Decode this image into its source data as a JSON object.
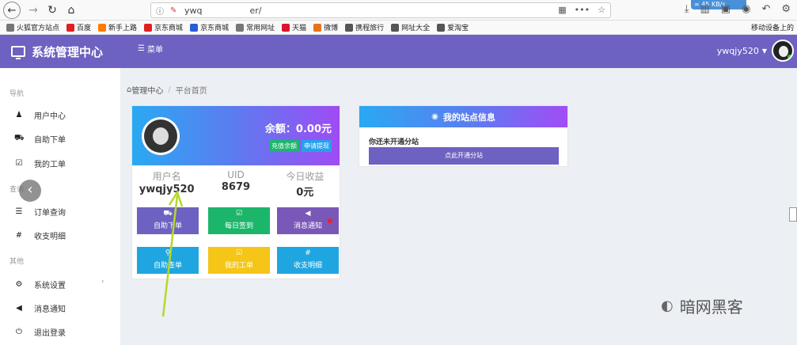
{
  "browser": {
    "url_prefix": "ywq",
    "url_suffix": "er/",
    "speed": "45 KB/s",
    "bookmarks": [
      {
        "label": "火狐官方站点",
        "color": "#777"
      },
      {
        "label": "百度",
        "color": "#e02020"
      },
      {
        "label": "新手上路",
        "color": "#ff7a00"
      },
      {
        "label": "京东商城",
        "color": "#e02020"
      },
      {
        "label": "京东商城",
        "color": "#2a5cd6"
      },
      {
        "label": "常用网址",
        "color": "#777"
      },
      {
        "label": "天猫",
        "color": "#d9162a"
      },
      {
        "label": "微博",
        "color": "#e8731d"
      },
      {
        "label": "携程旅行",
        "color": "#555"
      },
      {
        "label": "网址大全",
        "color": "#555"
      },
      {
        "label": "爱淘宝",
        "color": "#555"
      }
    ],
    "mobile_bookmarks": "移动设备上的"
  },
  "header": {
    "brand": "系统管理中心",
    "menu": "菜单",
    "username": "ywqjy520"
  },
  "sidebar": {
    "sections": [
      "导航",
      "查询",
      "其他"
    ],
    "items": [
      {
        "label": "用户中心",
        "icon": "user-icon",
        "glyph": "♟"
      },
      {
        "label": "自助下单",
        "icon": "cart-icon",
        "glyph": "🛒"
      },
      {
        "label": "我的工单",
        "icon": "checkbox-icon",
        "glyph": "☑"
      },
      {
        "label": "订单查询",
        "icon": "list-icon",
        "glyph": "☰"
      },
      {
        "label": "收支明细",
        "icon": "hash-icon",
        "glyph": "#"
      },
      {
        "label": "系统设置",
        "icon": "settings-icon",
        "glyph": "⚙"
      },
      {
        "label": "消息通知",
        "icon": "bullhorn-icon",
        "glyph": "📢"
      },
      {
        "label": "退出登录",
        "icon": "power-icon",
        "glyph": "⏻"
      }
    ]
  },
  "breadcrumb": {
    "home": "管理中心",
    "current": "平台首页"
  },
  "profile": {
    "balance": "余额：0.00元",
    "recharge": "充值余额",
    "withdraw": "申请提现",
    "stats": [
      {
        "label": "用户名",
        "value": "ywqjy520"
      },
      {
        "label": "UID",
        "value": "8679"
      },
      {
        "label": "今日收益",
        "value": "0元"
      }
    ],
    "tiles": [
      {
        "label": "自助下单",
        "glyph": "🛒",
        "color": "#6d62c1"
      },
      {
        "label": "每日签到",
        "glyph": "☑",
        "color": "#1cb66b"
      },
      {
        "label": "消息通知",
        "glyph": "📢",
        "color": "#7a58b8"
      },
      {
        "label": "自助查单",
        "glyph": "🔍",
        "color": "#1fa6e0"
      },
      {
        "label": "我的工单",
        "glyph": "☑",
        "color": "#f5c518"
      },
      {
        "label": "收支明细",
        "glyph": "#",
        "color": "#1fa6e0"
      }
    ]
  },
  "site": {
    "title": "我的站点信息",
    "message": "你还未开通分站",
    "button": "点此开通分站"
  },
  "watermark": "暗网黑客"
}
